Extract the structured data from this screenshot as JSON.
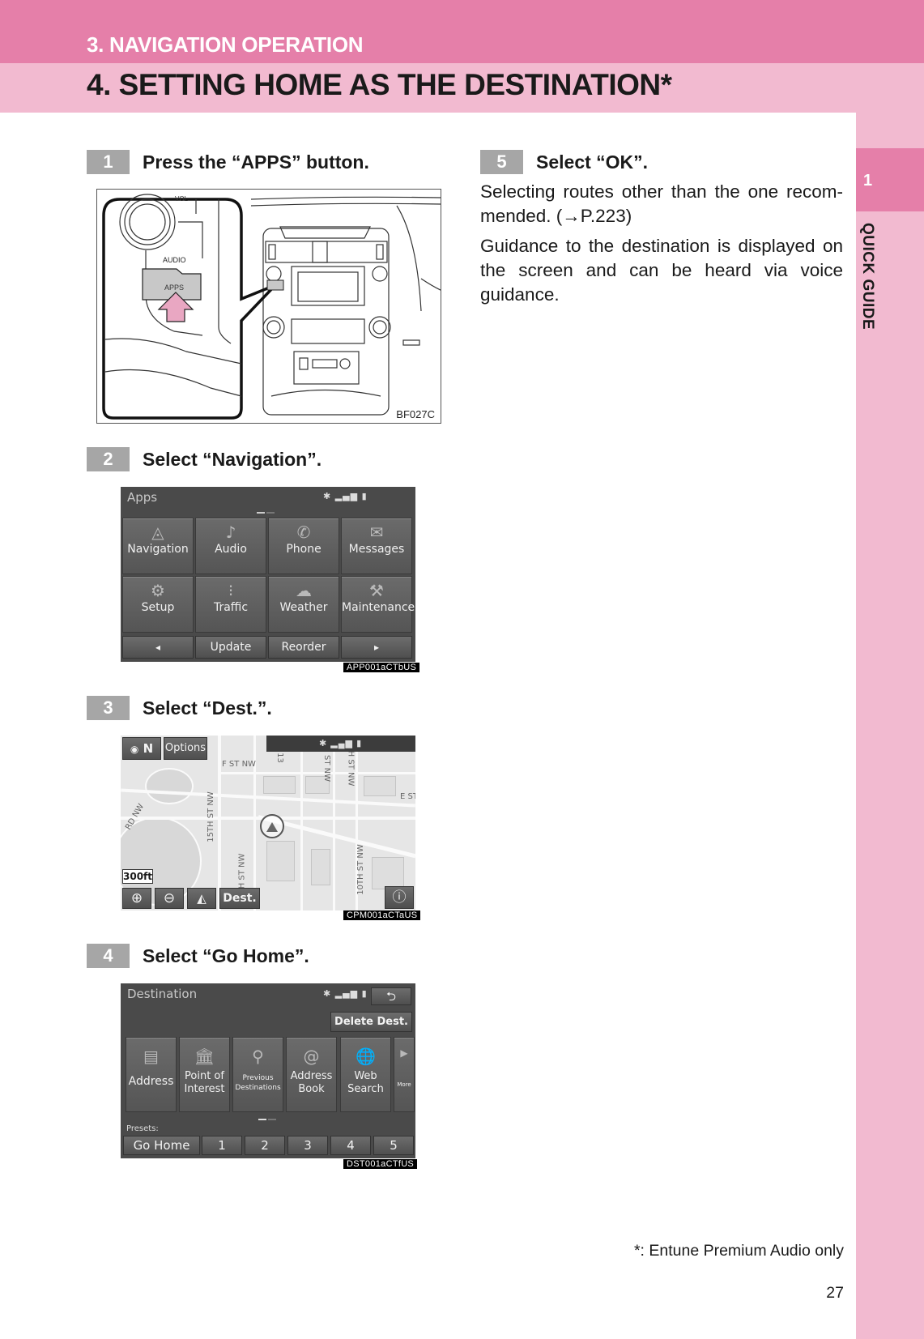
{
  "header": {
    "section": "3. NAVIGATION OPERATION",
    "title": "4. SETTING HOME AS THE DESTINATION*"
  },
  "sidebar": {
    "tab_number": "1",
    "label": "QUICK GUIDE"
  },
  "colors": {
    "header_dark_pink": "#e57fa9",
    "header_light_pink": "#f2bad0",
    "badge_gray": "#a6a6a6",
    "arrow_pink": "#e9a7c2"
  },
  "steps": [
    {
      "num": "1",
      "text": "Press the “APPS” button."
    },
    {
      "num": "2",
      "text": "Select “Navigation”."
    },
    {
      "num": "3",
      "text": "Select “Dest.”."
    },
    {
      "num": "4",
      "text": "Select “Go Home”."
    },
    {
      "num": "5",
      "text": "Select “OK”."
    }
  ],
  "figure1": {
    "labels": {
      "vol": "VOL",
      "audio": "AUDIO",
      "apps": "APPS"
    },
    "code": "BF027C"
  },
  "apps_screen": {
    "title": "Apps",
    "status_icons": [
      "bluetooth-icon",
      "signal-icon",
      "battery-icon"
    ],
    "tiles": [
      {
        "label": "Navigation",
        "icon": "compass-icon"
      },
      {
        "label": "Audio",
        "icon": "music-note-icon"
      },
      {
        "label": "Phone",
        "icon": "phone-icon"
      },
      {
        "label": "Messages",
        "icon": "envelope-icon"
      },
      {
        "label": "Setup",
        "icon": "gear-icon"
      },
      {
        "label": "Traffic",
        "icon": "traffic-light-icon"
      },
      {
        "label": "Weather",
        "icon": "weather-icon"
      },
      {
        "label": "Maintenance",
        "icon": "tools-icon"
      }
    ],
    "bottom": {
      "prev": "◂",
      "update": "Update",
      "reorder": "Reorder",
      "next": "▸"
    },
    "code": "APP001aCTbUS"
  },
  "map_screen": {
    "compass": "N",
    "options": "Options",
    "streets": [
      "F ST NW",
      "13",
      "ST NW",
      "H ST NW",
      "E ST",
      "15TH ST NW",
      "RD NW",
      "TH ST NW",
      "10TH ST NW"
    ],
    "scale": "300ft",
    "buttons": {
      "zoom_in": "⊕",
      "zoom_out": "⊖",
      "heading": "◭",
      "dest": "Dest.",
      "info": "ⓘ"
    },
    "code": "CPM001aCTaUS"
  },
  "dest_screen": {
    "title": "Destination",
    "back": "⮌",
    "delete": "Delete Dest.",
    "tiles": [
      {
        "label": "Address",
        "icon": "address-card-icon"
      },
      {
        "label": "Point of Interest",
        "icon": "building-icon"
      },
      {
        "label": "Previous Destinations",
        "icon": "previous-destinations-icon"
      },
      {
        "label": "Address Book",
        "icon": "address-book-icon"
      },
      {
        "label": "Web Search",
        "icon": "globe-search-icon"
      },
      {
        "label": "More",
        "icon": "chevron-right-icon"
      }
    ],
    "presets_label": "Presets:",
    "presets": [
      "Go Home",
      "1",
      "2",
      "3",
      "4",
      "5"
    ],
    "code": "DST001aCTfUS"
  },
  "step5": {
    "para1": "Selecting routes other than the one recom-mended. (→P.223)",
    "para2": "Guidance to the destination is displayed on the screen and can be heard via voice guidance."
  },
  "footnote": "*: Entune Premium Audio only",
  "page_number": "27"
}
